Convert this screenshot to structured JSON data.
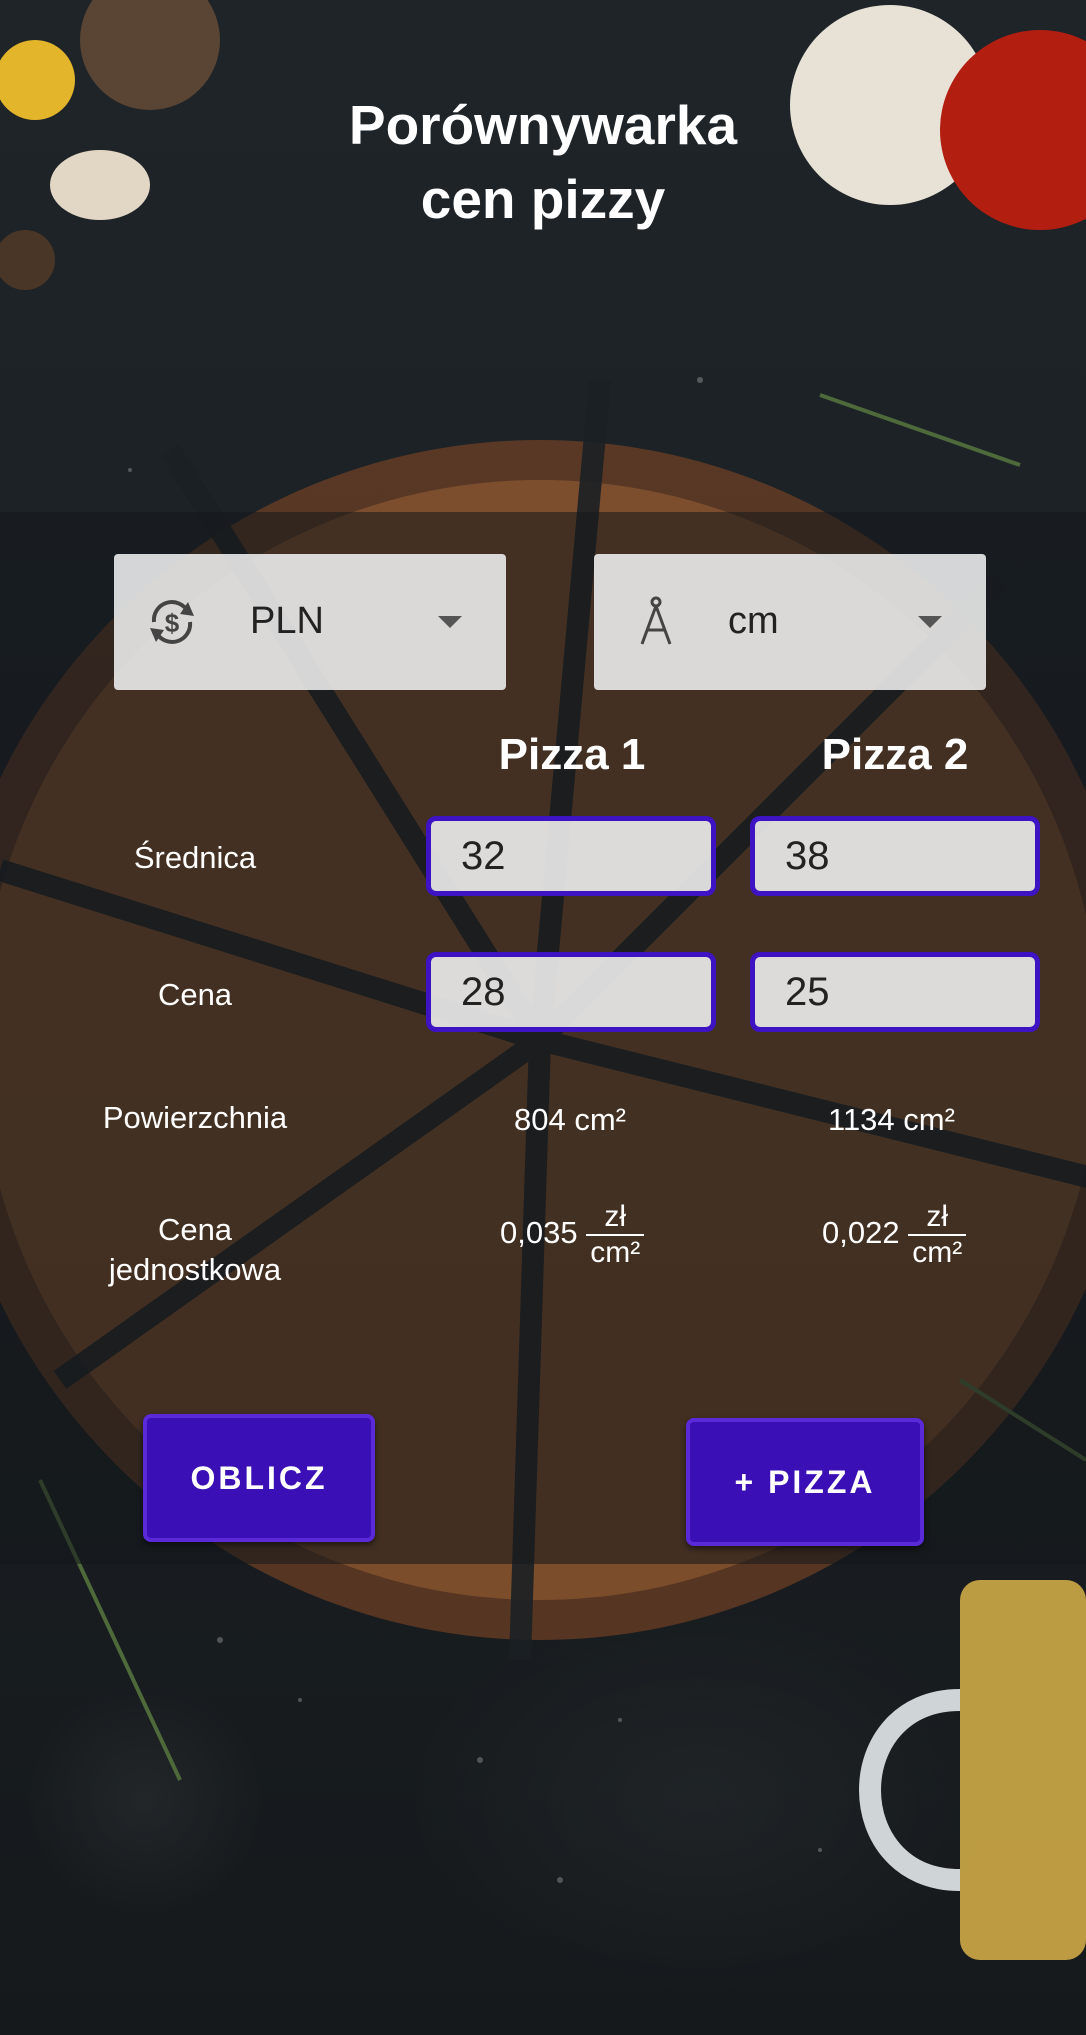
{
  "app": {
    "title_line1": "Porównywarka",
    "title_line2": "cen pizzy"
  },
  "currency_select": {
    "selected": "PLN",
    "icon": "currency-exchange-icon"
  },
  "unit_select": {
    "selected": "cm",
    "icon": "compass-icon"
  },
  "columns": {
    "pizza1": "Pizza 1",
    "pizza2": "Pizza 2"
  },
  "rows": {
    "diameter_label": "Średnica",
    "price_label": "Cena",
    "area_label": "Powierzchnia",
    "unit_price_label_1": "Cena",
    "unit_price_label_2": "jednostkowa"
  },
  "pizza1": {
    "diameter": "32",
    "price": "28",
    "area": "804 cm²",
    "unit_price": "0,035",
    "unit_num": "zł",
    "unit_den": "cm²"
  },
  "pizza2": {
    "diameter": "38",
    "price": "25",
    "area": "1134 cm²",
    "unit_price": "0,022",
    "unit_num": "zł",
    "unit_den": "cm²"
  },
  "buttons": {
    "calculate": "OBLICZ",
    "add_pizza": "+ PIZZA"
  },
  "colors": {
    "accent": "#3a0fb5",
    "input_border": "#3d13c4"
  }
}
